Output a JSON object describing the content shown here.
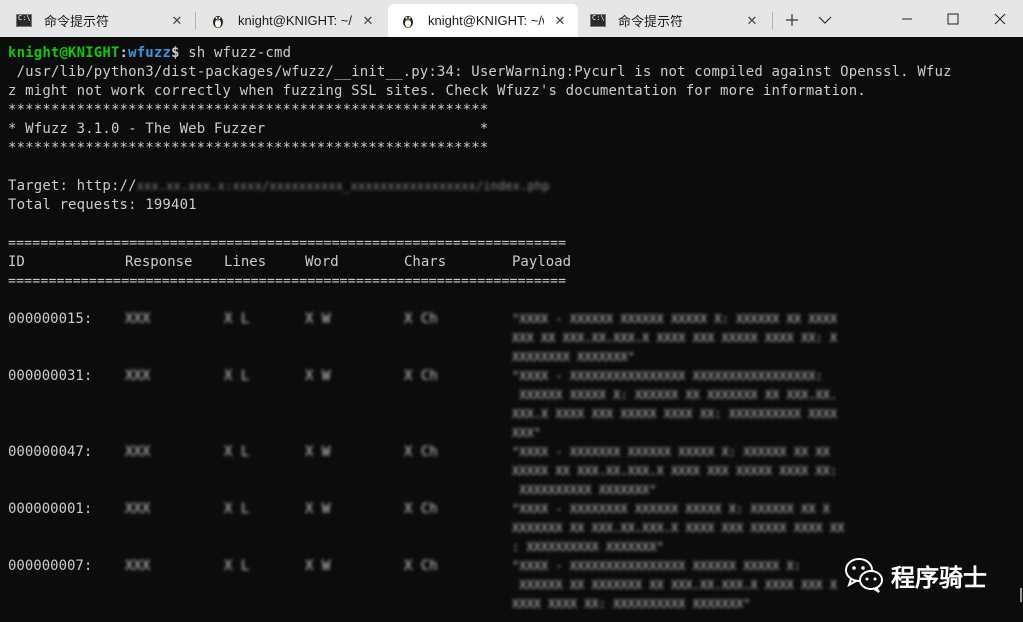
{
  "tabs": [
    {
      "title": "命令提示符",
      "icon": "cmd-icon",
      "active": false
    },
    {
      "title": "knight@KNIGHT: ~/fp",
      "icon": "linux-icon",
      "active": false
    },
    {
      "title": "knight@KNIGHT: ~/wf",
      "icon": "linux-icon",
      "active": true
    },
    {
      "title": "命令提示符",
      "icon": "cmd-icon",
      "active": false
    }
  ],
  "tab_close_glyph": "✕",
  "window_controls": {
    "minimize": "–",
    "maximize": "☐",
    "close": "✕"
  },
  "prompt": {
    "user_host": "knight@KNIGHT",
    "colon": ":",
    "path": "wfuzz",
    "symbol": "$",
    "command": " sh wfuzz-cmd"
  },
  "output": {
    "warning_1": " /usr/lib/python3/dist-packages/wfuzz/__init__.py:34: UserWarning:Pycurl is not compiled against Openssl. Wfuz",
    "warning_2": "z might not work correctly when fuzzing SSL sites. Check Wfuzz's documentation for more information.",
    "stars": "********************************************************",
    "banner": "* Wfuzz 3.1.0 - The Web Fuzzer                         *",
    "target_label": "Target: http://",
    "target_blurred": "xxx.xx.xxx.x:xxxx/xxxxxxxxxx_xxxxxxxxxxxxxxxxx/index.php",
    "total_requests": "Total requests: 199401",
    "rule": "====================================================================="
  },
  "table": {
    "headers": {
      "id": "ID",
      "response": "Response",
      "lines": "Lines",
      "word": "Word",
      "chars": "Chars",
      "payload": "Payload"
    },
    "rows": [
      {
        "id": "000000015:",
        "response": "XXX",
        "lines": "X L",
        "word": "X W",
        "chars": "X Ch",
        "payload": [
          "\"XXXX - XXXXXX XXXXXX XXXXX X: XXXXXX XX XXXX",
          "XXX XX XXX.XX.XXX.X XXXX XXX XXXXX XXXX XX: X",
          "XXXXXXXX XXXXXXX\""
        ]
      },
      {
        "id": "000000031:",
        "response": "XXX",
        "lines": "X L",
        "word": "X W",
        "chars": "X Ch",
        "payload": [
          "\"XXXX - XXXXXXXXXXXXXXXX XXXXXXXXXXXXXXXXX:",
          " XXXXXX XXXXX X: XXXXXX XX XXXXXXX XX XXX.XX.",
          "XXX.X XXXX XXX XXXXX XXXX XX: XXXXXXXXXX XXXX",
          "XXX\""
        ]
      },
      {
        "id": "000000047:",
        "response": "XXX",
        "lines": "X L",
        "word": "X W",
        "chars": "X Ch",
        "payload": [
          "\"XXXX - XXXXXXX XXXXXX XXXXX X: XXXXXX XX XX",
          "XXXXX XX XXX.XX.XXX.X XXXX XXX XXXXX XXXX XX:",
          " XXXXXXXXXX XXXXXXX\""
        ]
      },
      {
        "id": "000000001:",
        "response": "XXX",
        "lines": "X L",
        "word": "X W",
        "chars": "X Ch",
        "payload": [
          "\"XXXX - XXXXXXXX XXXXXX XXXXX X: XXXXXX XX X",
          "XXXXXXX XX XXX.XX.XXX.X XXXX XXX XXXXX XXXX XX",
          ": XXXXXXXXXX XXXXXXX\""
        ]
      },
      {
        "id": "000000007:",
        "response": "XXX",
        "lines": "X L",
        "word": "X W",
        "chars": "X Ch",
        "payload": [
          "\"XXXX - XXXXXXXXXXXXXXXX XXXXXX XXXXX X:",
          " XXXXXX XX XXXXXXX XX XXX.XX.XXX.X XXXX XXX X",
          "XXXX XXXX XX: XXXXXXXXXX XXXXXXX\""
        ]
      }
    ]
  },
  "watermark": {
    "text": "程序骑士",
    "icon": "wechat-icon"
  },
  "colors": {
    "prompt_user": "#16c60c",
    "prompt_path": "#3a96dd",
    "response_code": "#881798",
    "text": "#cccccc",
    "background": "#0c0c0c"
  }
}
